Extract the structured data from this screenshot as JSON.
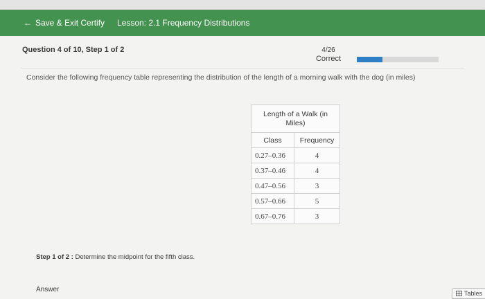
{
  "header": {
    "back_label": "Save & Exit Certify",
    "lesson_title": "Lesson: 2.1 Frequency Distributions"
  },
  "question": {
    "label": "Question 4 of 10, Step 1 of 2",
    "score": "4/26",
    "status": "Correct",
    "progress_fraction": 0.31
  },
  "prompt": "Consider the following frequency table representing the distribution of the length of a morning walk with the dog (in miles)",
  "table": {
    "caption_line1": "Length of a Walk (in",
    "caption_line2": "Miles)",
    "headers": [
      "Class",
      "Frequency"
    ],
    "rows": [
      {
        "class": "0.27–0.36",
        "frequency": "4"
      },
      {
        "class": "0.37–0.46",
        "frequency": "4"
      },
      {
        "class": "0.47–0.56",
        "frequency": "3"
      },
      {
        "class": "0.57–0.66",
        "frequency": "5"
      },
      {
        "class": "0.67–0.76",
        "frequency": "3"
      }
    ]
  },
  "step": {
    "prefix": "Step 1 of 2 :",
    "text": "Determine the midpoint for the fifth class."
  },
  "answer_label": "Answer",
  "tables_button": "Tables",
  "colors": {
    "header_bg": "#44924f",
    "progress_fill": "#2f7fc6"
  }
}
